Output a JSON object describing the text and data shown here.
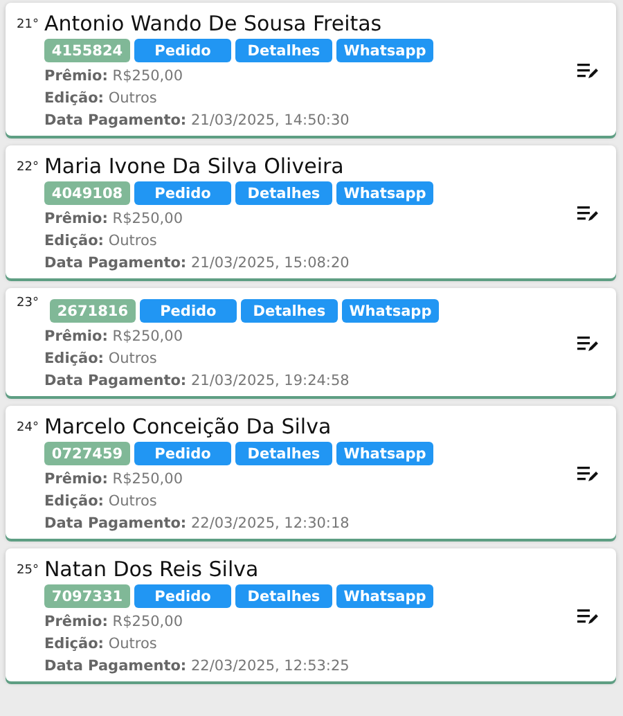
{
  "cards": [
    {
      "rank": "21°",
      "name": "Antonio Wando De Sousa Freitas",
      "code": "4155824",
      "buttons": [
        "Pedido",
        "Detalhes",
        "Whatsapp"
      ],
      "lines": [
        "**Prêmio:** R$250,00",
        "**Edição:** Outros",
        "**Data Pagamento:** 21/03/2025, 14:50:30"
      ]
    },
    {
      "rank": "22°",
      "name": "Maria Ivone Da Silva Oliveira",
      "code": "4049108",
      "buttons": [
        "Pedido",
        "Detalhes",
        "Whatsapp"
      ],
      "lines": [
        "**Prêmio:** R$250,00",
        "**Edição:** Outros",
        "**Data Pagamento:** 21/03/2025, 15:08:20"
      ]
    },
    {
      "rank": "23°",
      "code": "2671816",
      "buttons": [
        "Pedido",
        "Detalhes",
        "Whatsapp"
      ],
      "lines": [
        "**Prêmio:** R$250,00",
        "**Edição:** Outros",
        "**Data Pagamento:** 21/03/2025, 19:24:58"
      ]
    },
    {
      "rank": "24°",
      "name": "Marcelo Conceição Da Silva",
      "code": "0727459",
      "buttons": [
        "Pedido",
        "Detalhes",
        "Whatsapp"
      ],
      "lines": [
        "**Prêmio:** R$250,00",
        "**Edição:** Outros",
        "**Data Pagamento:** 22/03/2025, 12:30:18"
      ]
    },
    {
      "rank": "25°",
      "name": "Natan Dos Reis Silva",
      "code": "7097331",
      "buttons": [
        "Pedido",
        "Detalhes",
        "Whatsapp"
      ],
      "lines": [
        "**Prêmio:** R$250,00",
        "**Edição:** Outros",
        "**Data Pagamento:** 22/03/2025, 12:53:25"
      ]
    }
  ]
}
